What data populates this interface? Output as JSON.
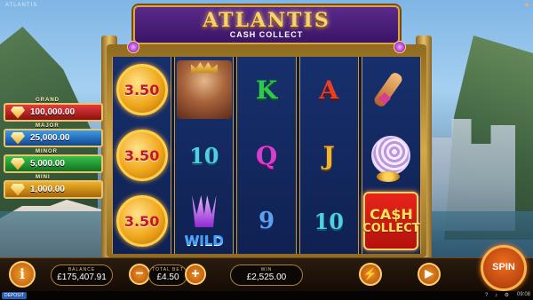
{
  "top": {
    "left_text": "ATLANTIS",
    "right_logo": ""
  },
  "title": {
    "main": "ATLANTIS",
    "sub": "CASH COLLECT"
  },
  "jackpots": [
    {
      "label": "GRAND",
      "value": "100,000.00",
      "color": "#d62a2a"
    },
    {
      "label": "MAJOR",
      "value": "25,000.00",
      "color": "#2f7fd1"
    },
    {
      "label": "MINOR",
      "value": "5,000.00",
      "color": "#28a83a"
    },
    {
      "label": "MINI",
      "value": "1,000.00",
      "color": "#e3a21c"
    }
  ],
  "reels": [
    [
      "3.50",
      "3.50",
      "3.50"
    ],
    [
      "king",
      "10",
      "WILD"
    ],
    [
      "K",
      "Q",
      "9"
    ],
    [
      "A",
      "J",
      "10"
    ],
    [
      "horn",
      "shell",
      "CASH COLLECT"
    ]
  ],
  "symbols": {
    "wild_text": "WILD",
    "cash_collect_line1": "CA$H",
    "cash_collect_line2": "COLLECT"
  },
  "bottom": {
    "info_label": "i",
    "balance_label": "BALANCE",
    "balance_value": "£175,407.91",
    "total_bet_label": "TOTAL BET",
    "total_bet_value": "£4.50",
    "minus_label": "−",
    "plus_label": "+",
    "win_label": "WIN",
    "win_value": "£2,525.00",
    "spin_label": "SPIN"
  },
  "status": {
    "deposit_label": "DEPOSIT",
    "clock": "09:08"
  },
  "colors": {
    "accent": "#f39b2c",
    "gold": "#e8c36a",
    "title_purple": "#4a1d78"
  }
}
